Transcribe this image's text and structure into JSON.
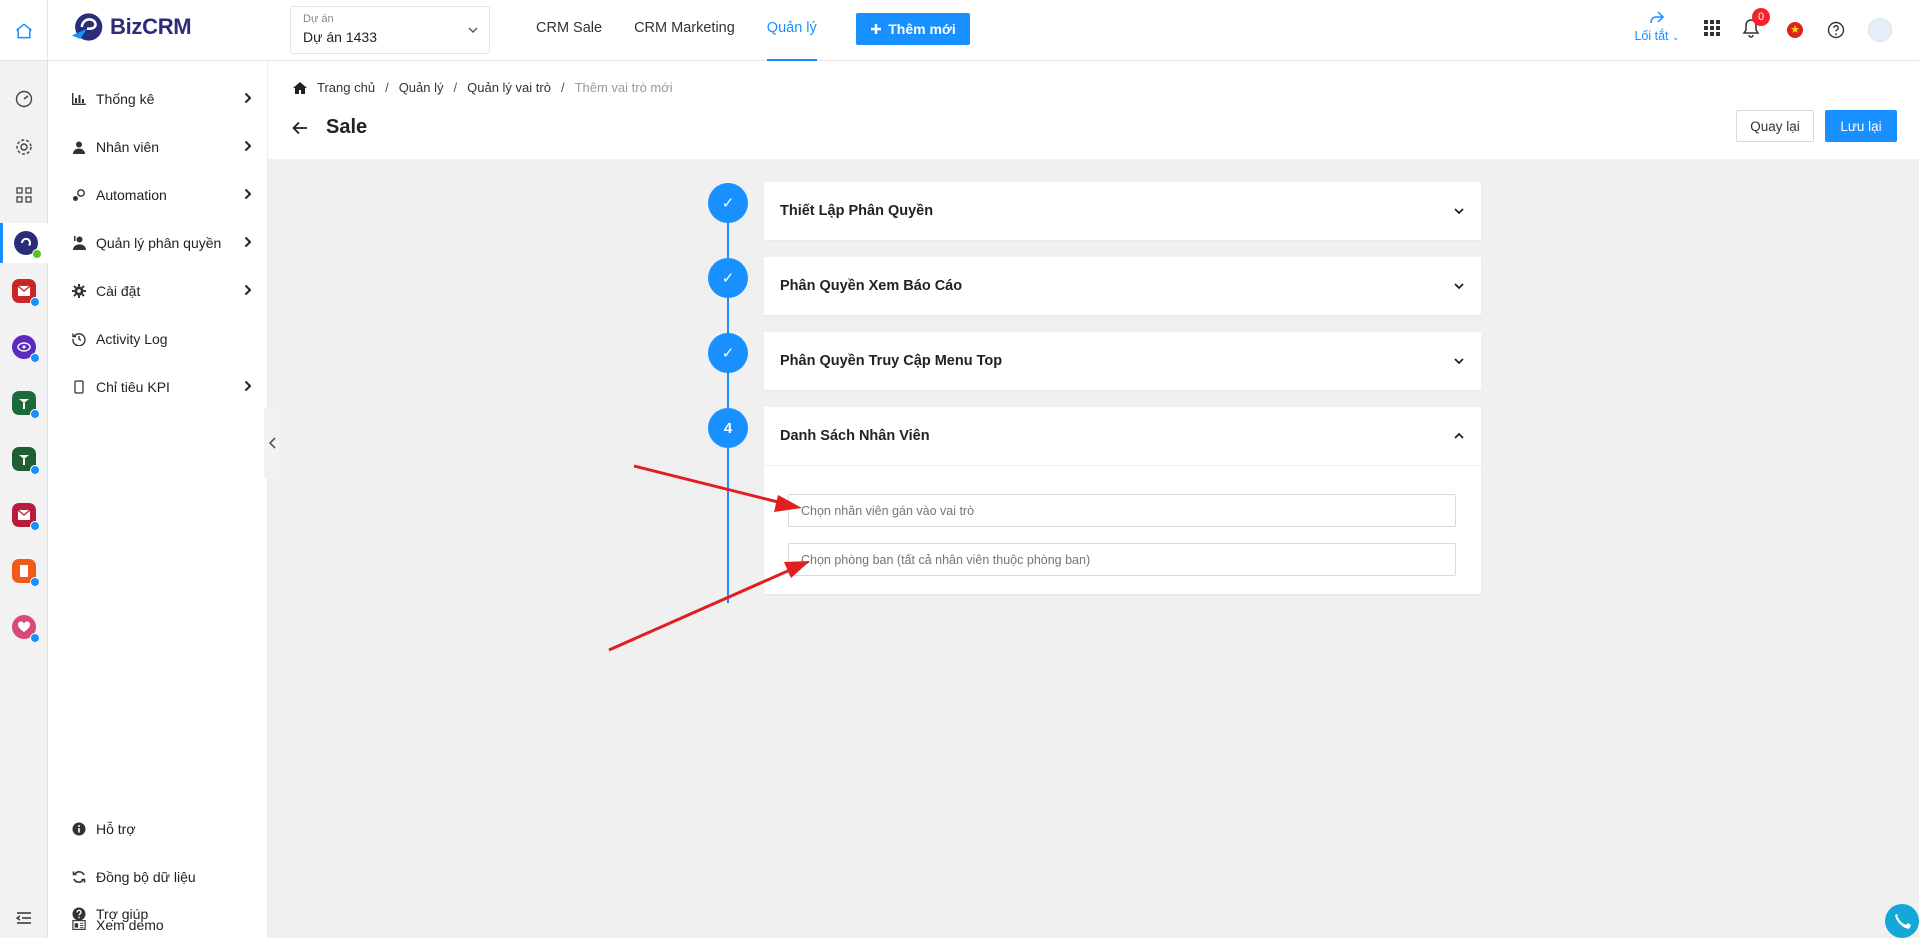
{
  "header": {
    "logo_biz": "Biz",
    "logo_crm": "CRM",
    "project": {
      "label": "Dự án",
      "value": "Dự án 1433"
    },
    "nav": [
      {
        "label": "CRM Sale",
        "active": false
      },
      {
        "label": "CRM Marketing",
        "active": false
      },
      {
        "label": "Quản lý",
        "active": true
      }
    ],
    "add_button": "Thêm mới",
    "shortcut_label": "Lối tắt",
    "notification_count": "0"
  },
  "rail": {
    "icons": [
      "home-icon",
      "dashboard-icon",
      "settings-icon",
      "grid-icon",
      "bizcrm-app-icon",
      "mail-app-icon",
      "eye-app-icon",
      "tree-app-icon",
      "tree-app-icon-2",
      "mail-app-icon-2",
      "doc-app-icon",
      "heart-app-icon",
      "menu-collapse-icon"
    ]
  },
  "sidebar": {
    "items": [
      {
        "label": "Thống kê",
        "icon": "chart-icon",
        "arrow": true
      },
      {
        "label": "Nhân viên",
        "icon": "user-icon",
        "arrow": true
      },
      {
        "label": "Automation",
        "icon": "automation-icon",
        "arrow": true
      },
      {
        "label": "Quản lý phân quyền",
        "icon": "permission-icon",
        "arrow": true
      },
      {
        "label": "Cài đặt",
        "icon": "gear-icon",
        "arrow": true
      },
      {
        "label": "Activity Log",
        "icon": "history-icon",
        "arrow": false
      },
      {
        "label": "Chỉ tiêu KPI",
        "icon": "phone-icon",
        "arrow": true
      }
    ],
    "bottom_items": [
      {
        "label": "Hỗ trợ",
        "icon": "info-icon"
      },
      {
        "label": "Đồng bộ dữ liệu",
        "icon": "sync-icon"
      },
      {
        "label": "Xem demo",
        "icon": "demo-icon"
      },
      {
        "label": "Trợ giúp",
        "icon": "question-icon"
      }
    ]
  },
  "breadcrumb": [
    "Trang chủ",
    "Quản lý",
    "Quản lý vai trò",
    "Thêm vai trò mới"
  ],
  "page": {
    "title": "Sale",
    "back_button": "Quay lại",
    "save_button": "Lưu lại"
  },
  "steps": [
    {
      "marker": "✓",
      "title": "Thiết Lập Phân Quyền",
      "expanded": false
    },
    {
      "marker": "✓",
      "title": "Phân Quyền Xem Báo Cáo",
      "expanded": false
    },
    {
      "marker": "✓",
      "title": "Phân Quyền Truy Cập Menu Top",
      "expanded": false
    },
    {
      "marker": "4",
      "title": "Danh Sách Nhân Viên",
      "expanded": true
    }
  ],
  "employee_panel": {
    "employee_placeholder": "Chọn nhân viên gán vào vai trò",
    "department_placeholder": "Chọn phòng ban (tất cả nhân viên thuộc phòng ban)"
  },
  "colors": {
    "primary": "#1890ff",
    "annotation_arrow": "#e02020",
    "badge": "#f5222d"
  }
}
